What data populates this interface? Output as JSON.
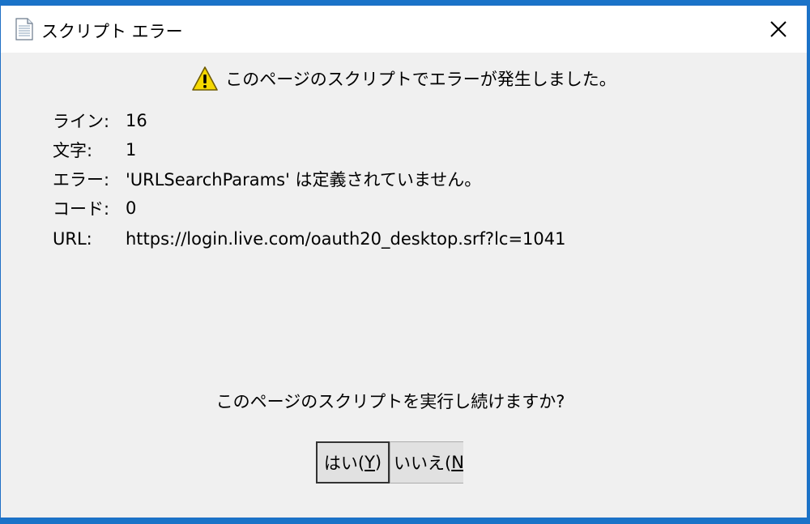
{
  "window": {
    "title": "スクリプト エラー",
    "close_glyph": "✕"
  },
  "header": {
    "message": "このページのスクリプトでエラーが発生しました。"
  },
  "details": [
    {
      "label": "ライン:",
      "value": "16"
    },
    {
      "label": "文字:",
      "value": "1"
    },
    {
      "label": "エラー:",
      "value": "'URLSearchParams' は定義されていません。"
    },
    {
      "label": "コード:",
      "value": "0"
    },
    {
      "label": "URL:",
      "value": "https://login.live.com/oauth20_desktop.srf?lc=1041"
    }
  ],
  "question": "このページのスクリプトを実行し続けますか?",
  "buttons": {
    "yes_label": "はい(",
    "yes_key": "Y",
    "yes_end": ")",
    "no_label": "いいえ(",
    "no_key": "N",
    "no_end": ")"
  },
  "icons": {
    "title": "document-icon",
    "warning": "warning-icon",
    "close": "close-icon"
  },
  "colors": {
    "desktop": "#1a73c8",
    "dialog_bg": "#f0f0f0",
    "warning_yellow": "#f5d800"
  }
}
